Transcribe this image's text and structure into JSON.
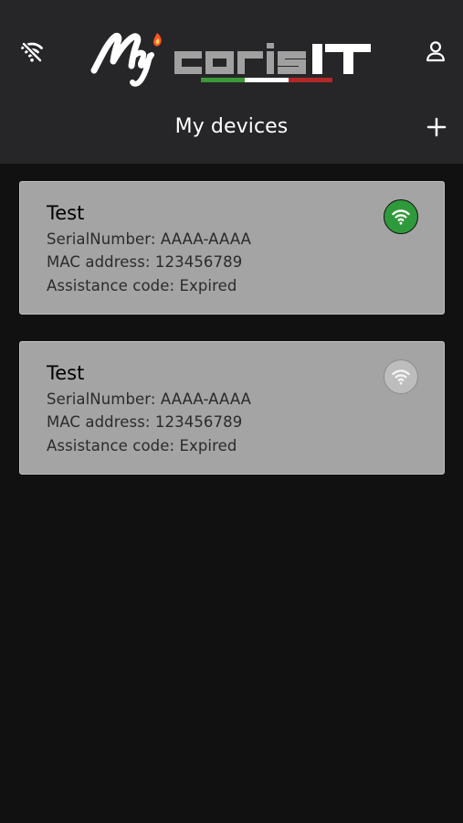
{
  "header": {
    "title": "My devices",
    "logo_text": "MycorisIT",
    "icons": [
      "wifi-off-icon",
      "user-icon",
      "plus-icon"
    ]
  },
  "devices": [
    {
      "name": "Test",
      "serial_line": "SerialNumber: AAAA-AAAA",
      "mac_line": "MAC address: 123456789",
      "assistance_line": "Assistance code: Expired",
      "connection_icon": "wifi-icon",
      "connection_color": "#2f9a3c"
    },
    {
      "name": "Test",
      "serial_line": "SerialNumber: AAAA-AAAA",
      "mac_line": "MAC address: 123456789",
      "assistance_line": "Assistance code: Expired",
      "connection_icon": "wifi-icon",
      "connection_color": "#bdbdbd"
    }
  ],
  "colors": {
    "background": "#111111",
    "header": "#262629",
    "card": "#a4a4a4",
    "online": "#2f9a3c",
    "offline": "#bdbdbd"
  }
}
